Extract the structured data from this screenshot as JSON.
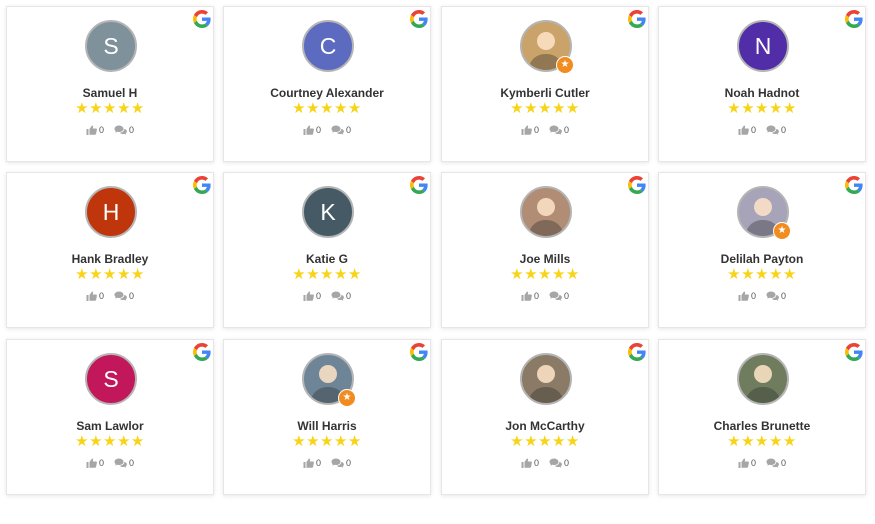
{
  "colors": {
    "star": "#f8d419",
    "badge": "#f28c1f",
    "avatar_border": "#b5b5b5"
  },
  "icons": {
    "source": "google-icon",
    "like": "thumbs-up-icon",
    "comment": "comment-icon",
    "badge": "local-guide-badge-icon",
    "star": "star-icon"
  },
  "reviews": [
    {
      "name": "Samuel H",
      "initial": "S",
      "avatar_color": "#7f929c",
      "photo": false,
      "badge": false,
      "rating": 5,
      "likes": "0",
      "comments": "0"
    },
    {
      "name": "Courtney Alexander",
      "initial": "C",
      "avatar_color": "#5c6bc0",
      "photo": false,
      "badge": false,
      "rating": 5,
      "likes": "0",
      "comments": "0"
    },
    {
      "name": "Kymberli Cutler",
      "initial": "",
      "avatar_color": "#c9a36a",
      "photo": true,
      "badge": true,
      "rating": 5,
      "likes": "0",
      "comments": "0"
    },
    {
      "name": "Noah Hadnot",
      "initial": "N",
      "avatar_color": "#512da8",
      "photo": false,
      "badge": false,
      "rating": 5,
      "likes": "0",
      "comments": "0"
    },
    {
      "name": "Hank Bradley",
      "initial": "H",
      "avatar_color": "#bf360c",
      "photo": false,
      "badge": false,
      "rating": 5,
      "likes": "0",
      "comments": "0"
    },
    {
      "name": "Katie G",
      "initial": "K",
      "avatar_color": "#455a64",
      "photo": false,
      "badge": false,
      "rating": 5,
      "likes": "0",
      "comments": "0"
    },
    {
      "name": "Joe Mills",
      "initial": "",
      "avatar_color": "#b08d74",
      "photo": true,
      "badge": false,
      "rating": 5,
      "likes": "0",
      "comments": "0"
    },
    {
      "name": "Delilah Payton",
      "initial": "",
      "avatar_color": "#a7a3b8",
      "photo": true,
      "badge": true,
      "rating": 5,
      "likes": "0",
      "comments": "0"
    },
    {
      "name": "Sam Lawlor",
      "initial": "S",
      "avatar_color": "#c2185b",
      "photo": false,
      "badge": false,
      "rating": 5,
      "likes": "0",
      "comments": "0"
    },
    {
      "name": "Will Harris",
      "initial": "",
      "avatar_color": "#6d8596",
      "photo": true,
      "badge": true,
      "rating": 5,
      "likes": "0",
      "comments": "0"
    },
    {
      "name": "Jon McCarthy",
      "initial": "",
      "avatar_color": "#8b7b66",
      "photo": true,
      "badge": false,
      "rating": 5,
      "likes": "0",
      "comments": "0"
    },
    {
      "name": "Charles Brunette",
      "initial": "",
      "avatar_color": "#6f7d5e",
      "photo": true,
      "badge": false,
      "rating": 5,
      "likes": "0",
      "comments": "0"
    }
  ]
}
